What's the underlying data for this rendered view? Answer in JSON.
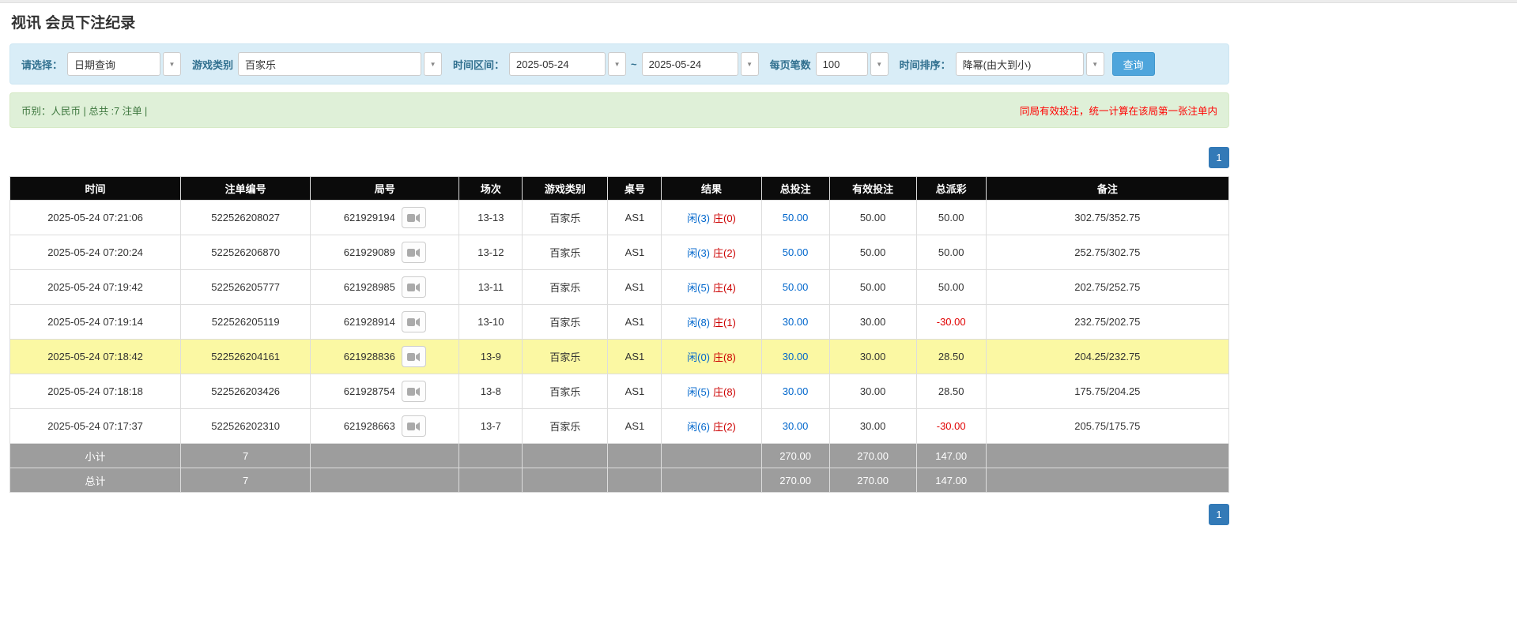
{
  "page": {
    "title": "视讯 会员下注纪录"
  },
  "filters": {
    "select_label": "请选择：",
    "select_value": "日期查询",
    "game_type_label": "游戏类别",
    "game_type_value": "百家乐",
    "time_range_label": "时间区间：",
    "date_from": "2025-05-24",
    "tilde": "~",
    "date_to": "2025-05-24",
    "page_size_label": "每页笔数",
    "page_size_value": "100",
    "sort_label": "时间排序：",
    "sort_value": "降幂(由大到小)",
    "search_button": "查询",
    "caret": "▼"
  },
  "summary": {
    "left": "币别：人民币 | 总共 :7 注单 |",
    "right": "同局有效投注，统一计算在该局第一张注单内"
  },
  "pagination": {
    "page": "1"
  },
  "colors": {
    "accent_blue": "#337ab7",
    "search_button_blue": "#4ea5dc",
    "highlight_yellow": "#fbf8a3",
    "negative_red": "#e00000",
    "player_blue": "#0066cc",
    "banker_red": "#cc0000",
    "header_black": "#0b0b0b",
    "footer_gray": "#9d9d9d",
    "alert_green_bg": "#dff0d8",
    "filter_blue_bg": "#d9edf7"
  },
  "table": {
    "headers": [
      "时间",
      "注单编号",
      "局号",
      "场次",
      "游戏类别",
      "桌号",
      "结果",
      "总投注",
      "有效投注",
      "总派彩",
      "备注"
    ],
    "rows": [
      {
        "time": "2025-05-24 07:21:06",
        "bet_id": "522526208027",
        "round_id": "621929194",
        "session": "13-13",
        "game": "百家乐",
        "table_no": "AS1",
        "result_player": "闲(3)",
        "result_banker": "庄(0)",
        "total_bet": "50.00",
        "valid_bet": "50.00",
        "payout": "50.00",
        "note": "302.75/352.75",
        "highlight": false
      },
      {
        "time": "2025-05-24 07:20:24",
        "bet_id": "522526206870",
        "round_id": "621929089",
        "session": "13-12",
        "game": "百家乐",
        "table_no": "AS1",
        "result_player": "闲(3)",
        "result_banker": "庄(2)",
        "total_bet": "50.00",
        "valid_bet": "50.00",
        "payout": "50.00",
        "note": "252.75/302.75",
        "highlight": false
      },
      {
        "time": "2025-05-24 07:19:42",
        "bet_id": "522526205777",
        "round_id": "621928985",
        "session": "13-11",
        "game": "百家乐",
        "table_no": "AS1",
        "result_player": "闲(5)",
        "result_banker": "庄(4)",
        "total_bet": "50.00",
        "valid_bet": "50.00",
        "payout": "50.00",
        "note": "202.75/252.75",
        "highlight": false
      },
      {
        "time": "2025-05-24 07:19:14",
        "bet_id": "522526205119",
        "round_id": "621928914",
        "session": "13-10",
        "game": "百家乐",
        "table_no": "AS1",
        "result_player": "闲(8)",
        "result_banker": "庄(1)",
        "total_bet": "30.00",
        "valid_bet": "30.00",
        "payout": "-30.00",
        "note": "232.75/202.75",
        "highlight": false
      },
      {
        "time": "2025-05-24 07:18:42",
        "bet_id": "522526204161",
        "round_id": "621928836",
        "session": "13-9",
        "game": "百家乐",
        "table_no": "AS1",
        "result_player": "闲(0)",
        "result_banker": "庄(8)",
        "total_bet": "30.00",
        "valid_bet": "30.00",
        "payout": "28.50",
        "note": "204.25/232.75",
        "highlight": true
      },
      {
        "time": "2025-05-24 07:18:18",
        "bet_id": "522526203426",
        "round_id": "621928754",
        "session": "13-8",
        "game": "百家乐",
        "table_no": "AS1",
        "result_player": "闲(5)",
        "result_banker": "庄(8)",
        "total_bet": "30.00",
        "valid_bet": "30.00",
        "payout": "28.50",
        "note": "175.75/204.25",
        "highlight": false
      },
      {
        "time": "2025-05-24 07:17:37",
        "bet_id": "522526202310",
        "round_id": "621928663",
        "session": "13-7",
        "game": "百家乐",
        "table_no": "AS1",
        "result_player": "闲(6)",
        "result_banker": "庄(2)",
        "total_bet": "30.00",
        "valid_bet": "30.00",
        "payout": "-30.00",
        "note": "205.75/175.75",
        "highlight": false
      }
    ],
    "subtotal": {
      "label": "小计",
      "count": "7",
      "total_bet": "270.00",
      "valid_bet": "270.00",
      "payout": "147.00"
    },
    "total": {
      "label": "总计",
      "count": "7",
      "total_bet": "270.00",
      "valid_bet": "270.00",
      "payout": "147.00"
    }
  }
}
